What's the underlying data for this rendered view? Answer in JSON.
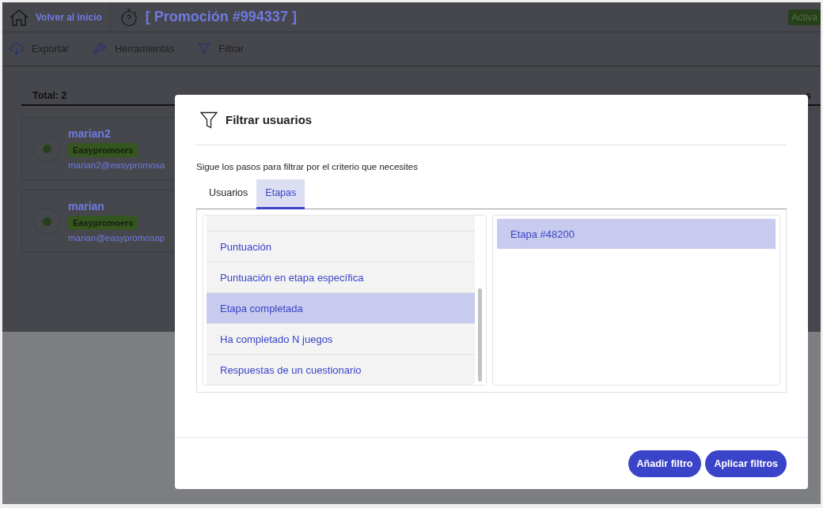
{
  "topbar": {
    "home_label": "Volver al inicio",
    "title": "[ Promoción #994337 ]",
    "status": "Activa"
  },
  "toolbar": [
    {
      "kind": "export",
      "label": "Exportar"
    },
    {
      "kind": "tools",
      "label": "Herramientas"
    },
    {
      "kind": "filter",
      "label": "Filtrar"
    }
  ],
  "list_header": {
    "total": "Total: 2",
    "column_2": "s"
  },
  "users": [
    {
      "name": "marian2",
      "group": "Easypromoers",
      "email": "marian2@easypromosa"
    },
    {
      "name": "marian",
      "group": "Easypromoers",
      "email": "marian@easypromosap"
    }
  ],
  "dialog": {
    "title": "Filtrar usuarios",
    "description": "Sigue los pasos para filtrar por el criterio que necesites",
    "tabs": [
      {
        "label": "Usuarios",
        "selected": false
      },
      {
        "label": "Etapas",
        "selected": true
      }
    ],
    "criteria": [
      {
        "label": "Puntuación",
        "selected": false
      },
      {
        "label": "Puntuación en etapa específica",
        "selected": false
      },
      {
        "label": "Etapa completada",
        "selected": true
      },
      {
        "label": "Ha completado N juegos",
        "selected": false
      },
      {
        "label": "Respuestas de un cuestionario",
        "selected": false
      }
    ],
    "values": [
      {
        "label": "Etapa #48200",
        "selected": true
      }
    ],
    "buttons": [
      "Añadir filtro",
      "Aplicar filtros"
    ]
  }
}
